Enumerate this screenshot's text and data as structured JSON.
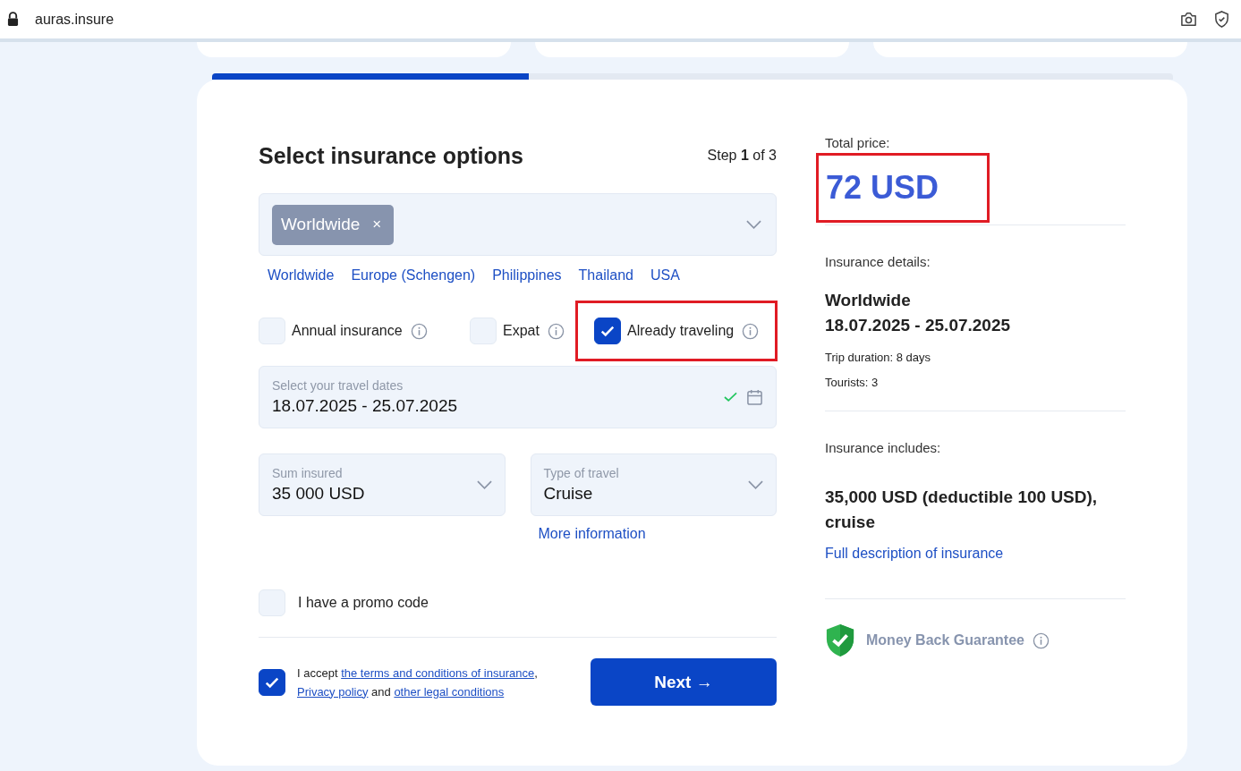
{
  "browser": {
    "url": "auras.insure"
  },
  "progress": {
    "level": 0.33
  },
  "form": {
    "title": "Select insurance options",
    "step": "Step **1** of 3",
    "region_select": {
      "tags": [
        "Worldwide"
      ],
      "remove": "×"
    },
    "quick_regions": [
      "Worldwide",
      "Europe (Schengen)",
      "Philippines",
      "Thailand",
      "USA"
    ],
    "options": [
      {
        "label": "Annual insurance",
        "checked": false,
        "highlighted": false
      },
      {
        "label": "Expat",
        "checked": false,
        "highlighted": false
      },
      {
        "label": "Already traveling",
        "checked": true,
        "highlighted": true
      }
    ],
    "dates": {
      "label": "Select your travel dates",
      "value": "18.07.2025 - 25.07.2025",
      "valid": true
    },
    "sum_insured": {
      "label": "Sum insured",
      "value": "35 000 USD"
    },
    "travel_type": {
      "label": "Type of travel",
      "value": "Cruise"
    },
    "more_info": "More information",
    "promo": {
      "label": "I have a promo code",
      "checked": false
    },
    "accept": {
      "checked": true,
      "parts": [
        {
          "kind": "text",
          "text": "I accept "
        },
        {
          "kind": "link",
          "text": "the terms and conditions of insurance"
        },
        {
          "kind": "text",
          "text": ","
        },
        {
          "kind": "break"
        },
        {
          "kind": "link",
          "text": "Privacy policy"
        },
        {
          "kind": "text",
          "text": " and "
        },
        {
          "kind": "link",
          "text": "other legal conditions"
        }
      ]
    },
    "next": "Next →"
  },
  "summary": {
    "price_label": "Total price:",
    "price": "72 USD",
    "price_highlighted": true,
    "details_label": "Insurance details:",
    "destination": "Worldwide",
    "dates": "18.07.2025 - 25.07.2025",
    "duration": "Trip duration: 8 days",
    "tourists": "Tourists: 3",
    "includes_label": "Insurance includes:",
    "includes": "35,000 USD (deductible 100 USD), cruise",
    "description_link": "Full description of insurance",
    "guarantee": "Money Back Guarantee"
  }
}
